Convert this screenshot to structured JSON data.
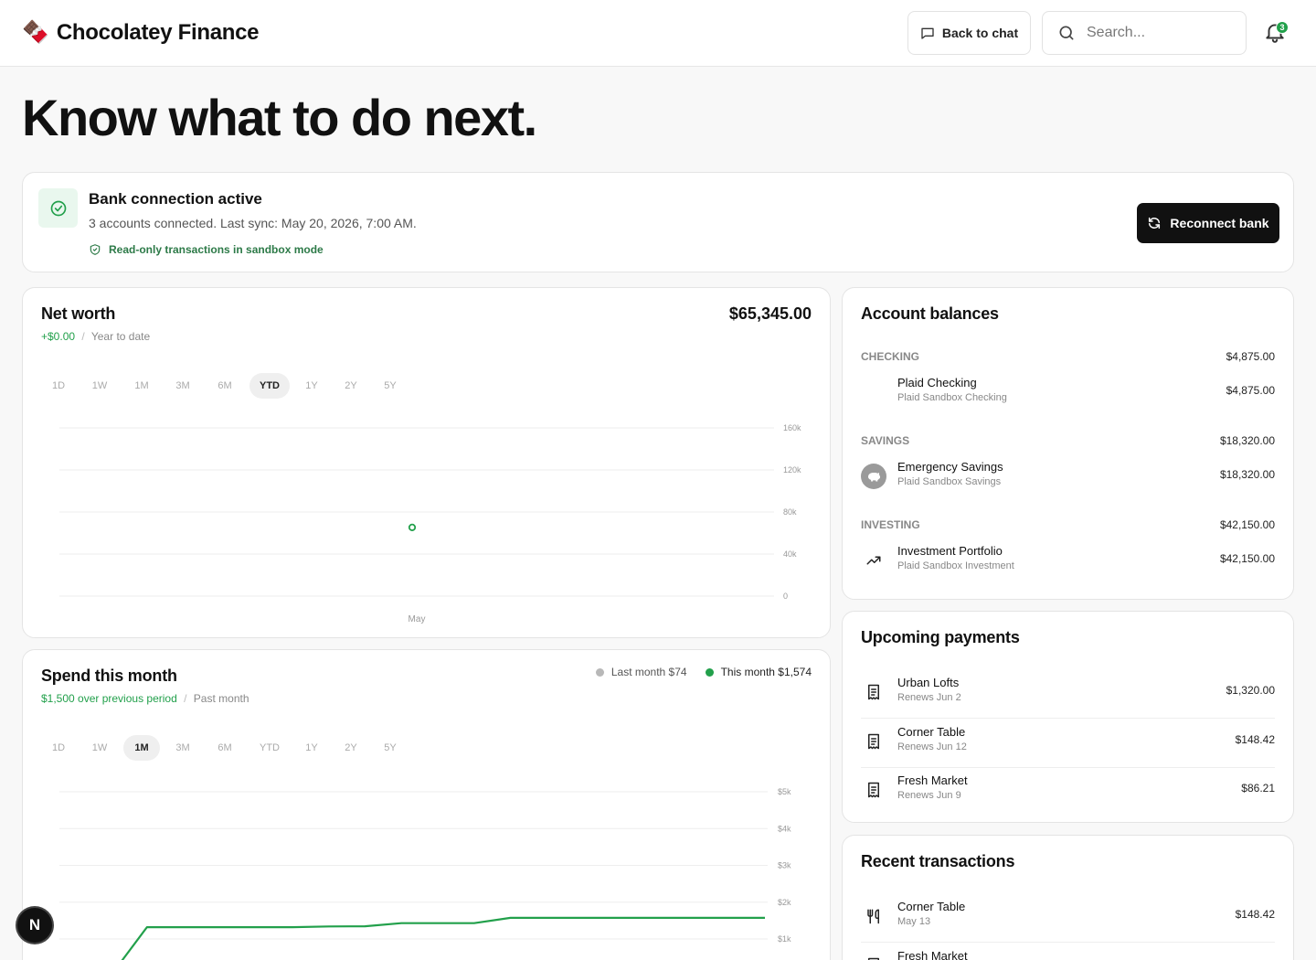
{
  "app": {
    "logo_icon": "chocolate-bar-icon",
    "logo_glyph": "🍫",
    "name": "Chocolatey Finance"
  },
  "header": {
    "back_to_chat": "Back to chat",
    "search_placeholder": "Search...",
    "notification_count": "3"
  },
  "hero": {
    "title": "Know what to do next."
  },
  "bank": {
    "title": "Bank connection active",
    "subtitle": "3 accounts connected. Last sync: May 20, 2026, 7:00 AM.",
    "note": "Read-only transactions in sandbox mode",
    "reconnect": "Reconnect bank"
  },
  "net_worth": {
    "title": "Net worth",
    "value": "$65,345.00",
    "delta": "+$0.00",
    "separator": "/",
    "period": "Year to date",
    "ranges": [
      "1D",
      "1W",
      "1M",
      "3M",
      "6M",
      "YTD",
      "1Y",
      "2Y",
      "5Y"
    ],
    "active_range": "YTD"
  },
  "spend": {
    "title": "Spend this month",
    "delta": "$1,500 over previous period",
    "separator": "/",
    "period": "Past month",
    "legend_last": "Last month $74",
    "legend_this": "This month $1,574",
    "ranges": [
      "1D",
      "1W",
      "1M",
      "3M",
      "6M",
      "YTD",
      "1Y",
      "2Y",
      "5Y"
    ],
    "active_range": "1M"
  },
  "accounts": {
    "title": "Account balances",
    "groups": [
      {
        "label": "CHECKING",
        "total": "$4,875.00",
        "accounts": [
          {
            "name": "Plaid Checking",
            "sub": "Plaid Sandbox Checking",
            "amount": "$4,875.00",
            "icon": "none"
          }
        ]
      },
      {
        "label": "SAVINGS",
        "total": "$18,320.00",
        "accounts": [
          {
            "name": "Emergency Savings",
            "sub": "Plaid Sandbox Savings",
            "amount": "$18,320.00",
            "icon": "piggy-bank-icon"
          }
        ]
      },
      {
        "label": "INVESTING",
        "total": "$42,150.00",
        "accounts": [
          {
            "name": "Investment Portfolio",
            "sub": "Plaid Sandbox Investment",
            "amount": "$42,150.00",
            "icon": "trending-up-icon"
          }
        ]
      }
    ]
  },
  "upcoming": {
    "title": "Upcoming payments",
    "items": [
      {
        "name": "Urban Lofts",
        "sub": "Renews Jun 2",
        "amount": "$1,320.00",
        "icon": "receipt-icon"
      },
      {
        "name": "Corner Table",
        "sub": "Renews Jun 12",
        "amount": "$148.42",
        "icon": "receipt-icon"
      },
      {
        "name": "Fresh Market",
        "sub": "Renews Jun 9",
        "amount": "$86.21",
        "icon": "receipt-icon"
      }
    ]
  },
  "recent": {
    "title": "Recent transactions",
    "items": [
      {
        "name": "Corner Table",
        "sub": "May 13",
        "amount": "$148.42",
        "icon": "utensils-icon"
      },
      {
        "name": "Fresh Market",
        "sub": "",
        "amount": "",
        "icon": "receipt-icon"
      }
    ]
  },
  "colors": {
    "accent_green": "#22a04b",
    "primary_button": "#111111",
    "muted_gray": "#b8b8b8"
  },
  "dev_badge": "N",
  "chart_data": [
    {
      "type": "scatter",
      "title": "Net worth",
      "x_ticks": [
        "May"
      ],
      "y_ticks": [
        "0",
        "40k",
        "80k",
        "120k",
        "160k"
      ],
      "ylim": [
        0,
        160000
      ],
      "grid": true,
      "series": [
        {
          "name": "",
          "points": [
            {
              "x": "May",
              "y": 65345
            }
          ]
        }
      ]
    },
    {
      "type": "line",
      "title": "Spend this month",
      "y_ticks": [
        "$1k",
        "$2k",
        "$3k",
        "$4k",
        "$5k"
      ],
      "ylim": [
        0,
        5000
      ],
      "grid": true,
      "legend": "top-right",
      "series": [
        {
          "name": "This month $1,574",
          "color": "#22a04b",
          "values": [
            0,
            1320,
            1320,
            1320,
            1320,
            1320,
            1340,
            1345,
            1430,
            1430,
            1430,
            1574,
            1574,
            1574,
            1574,
            1574,
            1574,
            1574,
            1574
          ]
        }
      ]
    }
  ]
}
